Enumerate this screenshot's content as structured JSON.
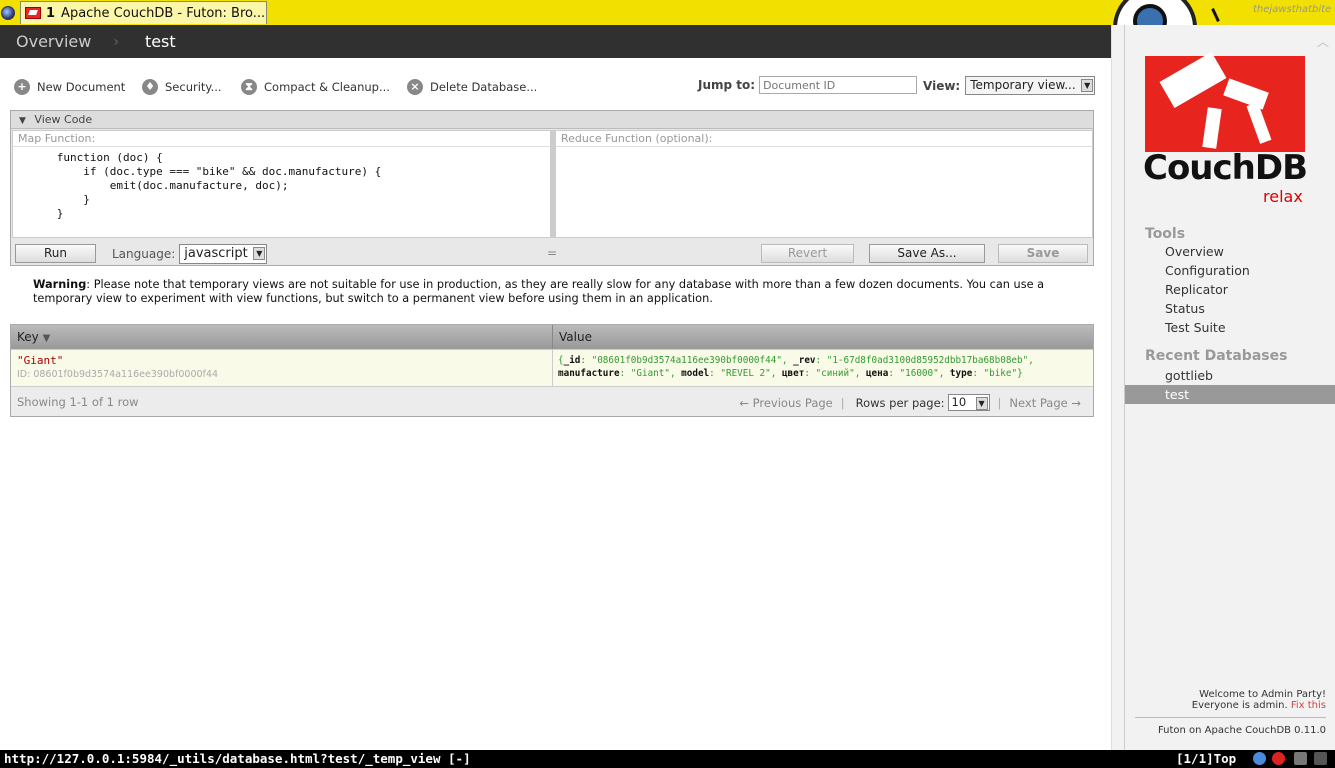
{
  "browser": {
    "tab_index": "1",
    "tab_title": "Apache CouchDB - Futon: Bro...",
    "theme_signature": "thejawsthatbite",
    "status_url": "http://127.0.0.1:5984/_utils/database.html?test/_temp_view [-]",
    "status_position": "[1/1]Top"
  },
  "breadcrumb": {
    "root": "Overview",
    "sep": "›",
    "current": "test"
  },
  "toolbar": {
    "new_document": "New Document",
    "security": "Security...",
    "compact": "Compact & Cleanup...",
    "delete": "Delete Database...",
    "jump_label": "Jump to:",
    "jump_placeholder": "Document ID",
    "view_label": "View:",
    "view_value": "Temporary view..."
  },
  "code": {
    "header": "View Code",
    "map_label": "Map Function:",
    "map_source": "      function (doc) {\n          if (doc.type === \"bike\" && doc.manufacture) {\n              emit(doc.manufacture, doc);\n          }\n      }",
    "reduce_label": "Reduce Function (optional):",
    "run": "Run",
    "language_label": "Language:",
    "language_value": "javascript",
    "divider": "=",
    "revert": "Revert",
    "save_as": "Save As...",
    "save": "Save"
  },
  "warning": {
    "title": "Warning",
    "text": ": Please note that temporary views are not suitable for use in production, as they are really slow for any database with more than a few dozen documents. You can use a temporary view to experiment with view functions, but switch to a permanent view before using them in an application."
  },
  "results": {
    "key_header": "Key",
    "value_header": "Value",
    "rows": [
      {
        "key": "\"Giant\"",
        "id": "ID: 08601f0b9d3574a116ee390bf0000f44",
        "value_id": "\"08601f0b9d3574a116ee390bf0000f44\"",
        "value_rev": "\"1-67d8f0ad3100d85952dbb17ba68b08eb\"",
        "value_manufacture": "\"Giant\"",
        "value_model": "\"REVEL 2\"",
        "value_color": "\"синий\"",
        "value_price": "\"16000\"",
        "value_type": "\"bike\""
      }
    ],
    "showing": "Showing 1-1 of 1 row",
    "prev": "← Previous Page",
    "rows_per_page_label": "Rows per page:",
    "rows_per_page": "10",
    "next": "Next Page →"
  },
  "sidebar": {
    "logo_text": "CouchDB",
    "logo_tagline": "relax",
    "tools_heading": "Tools",
    "tools": [
      "Overview",
      "Configuration",
      "Replicator",
      "Status",
      "Test Suite"
    ],
    "recent_heading": "Recent Databases",
    "recent": [
      "gottlieb",
      "test"
    ],
    "welcome": "Welcome to Admin Party!",
    "everyone": "Everyone is admin.",
    "fix": "Fix this",
    "version": "Futon on Apache CouchDB 0.11.0"
  },
  "colors": {
    "accent_red": "#e8241e",
    "header_dark": "#303030",
    "tabbar_yellow": "#f2e100"
  }
}
